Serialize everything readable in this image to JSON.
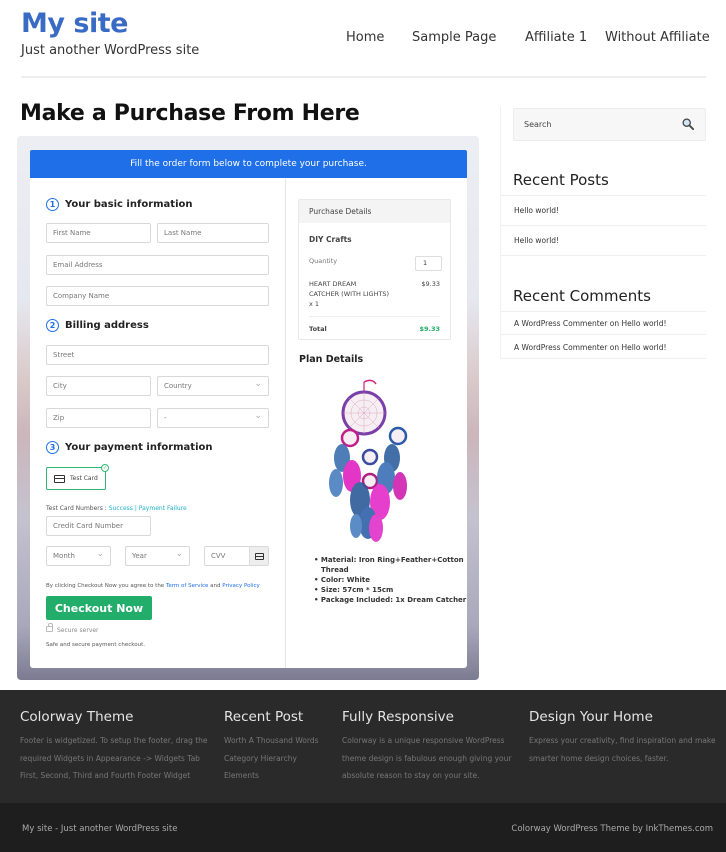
{
  "header": {
    "site_title": "My site",
    "site_description": "Just another WordPress site",
    "nav": [
      "Home",
      "Sample Page",
      "Affiliate 1",
      "Without Affiliate"
    ]
  },
  "main": {
    "page_title": "Make a Purchase From Here",
    "banner": "Fill the order form below to complete your purchase.",
    "steps": [
      {
        "number": "1",
        "label": "Your basic information"
      },
      {
        "number": "2",
        "label": "Billing address"
      },
      {
        "number": "3",
        "label": "Your payment information"
      }
    ],
    "fields": {
      "first_name": "First Name",
      "last_name": "Last Name",
      "email": "Email Address",
      "company": "Company Name",
      "street": "Street",
      "city": "City",
      "country": "Country",
      "zip": "Zip",
      "state": "-",
      "card_number": "Credit Card Number",
      "month": "Month",
      "year": "Year",
      "cvv": "CVV"
    },
    "payment_method": "Test Card",
    "test_card_label": "Test Card Numbers :",
    "test_success": "Success",
    "test_separator": "|",
    "test_failure": "Payment Failure",
    "agree_prefix": "By clicking Checkout Now you agree to the",
    "terms": "Term of Service",
    "and": "and",
    "privacy": "Privacy Policy",
    "checkout_button": "Checkout Now",
    "secure_server": "Secure server",
    "safe_text": "Safe and secure payment checkout.",
    "purchase": {
      "header": "Purchase Details",
      "product_group": "DIY Crafts",
      "quantity_label": "Quantity",
      "quantity_value": "1",
      "item_line1": "HEART DREAM",
      "item_line2": "CATCHER (WITH LIGHTS)",
      "item_line3": "x 1",
      "item_price": "$9.33",
      "total_label": "Total",
      "total_value": "$9.33",
      "total_color": "#22ad6b"
    },
    "plan": {
      "title": "Plan Details",
      "specs": [
        "• Material: Iron Ring+Feather+Cotton",
        "   Thread",
        "• Color: White",
        "• Size: 57cm * 15cm",
        "• Package Included: 1x Dream Catcher"
      ]
    }
  },
  "sidebar": {
    "search_placeholder": "Search",
    "recent_posts_title": "Recent Posts",
    "recent_posts": [
      "Hello world!",
      "Hello world!"
    ],
    "recent_comments_title": "Recent Comments",
    "recent_comments": [
      "A WordPress Commenter on Hello world!",
      "A WordPress Commenter on Hello world!"
    ]
  },
  "footer": {
    "columns": [
      {
        "title": "Colorway Theme",
        "lines": [
          "Footer is widgetized. To setup the footer, drag the",
          "required Widgets in Appearance -> Widgets Tab",
          "First, Second, Third and Fourth Footer Widget"
        ]
      },
      {
        "title": "Recent Post",
        "lines": [
          "Worth A Thousand Words",
          "Category Hierarchy",
          "Elements"
        ]
      },
      {
        "title": "Fully Responsive",
        "lines": [
          "Colorway is a unique responsive WordPress",
          "theme design is fabulous enough giving your",
          "absolute reason to stay on your site."
        ]
      },
      {
        "title": "Design Your Home",
        "lines": [
          "Express your creativity, find inspiration and make",
          "smarter home design choices, faster."
        ]
      }
    ],
    "bottom_left": "My site - Just another WordPress site",
    "bottom_right": "Colorway WordPress Theme by InkThemes.com"
  },
  "colors": {
    "brand": "#3a6bc4",
    "banner": "#1e6fe8",
    "checkout": "#22ad6b"
  }
}
